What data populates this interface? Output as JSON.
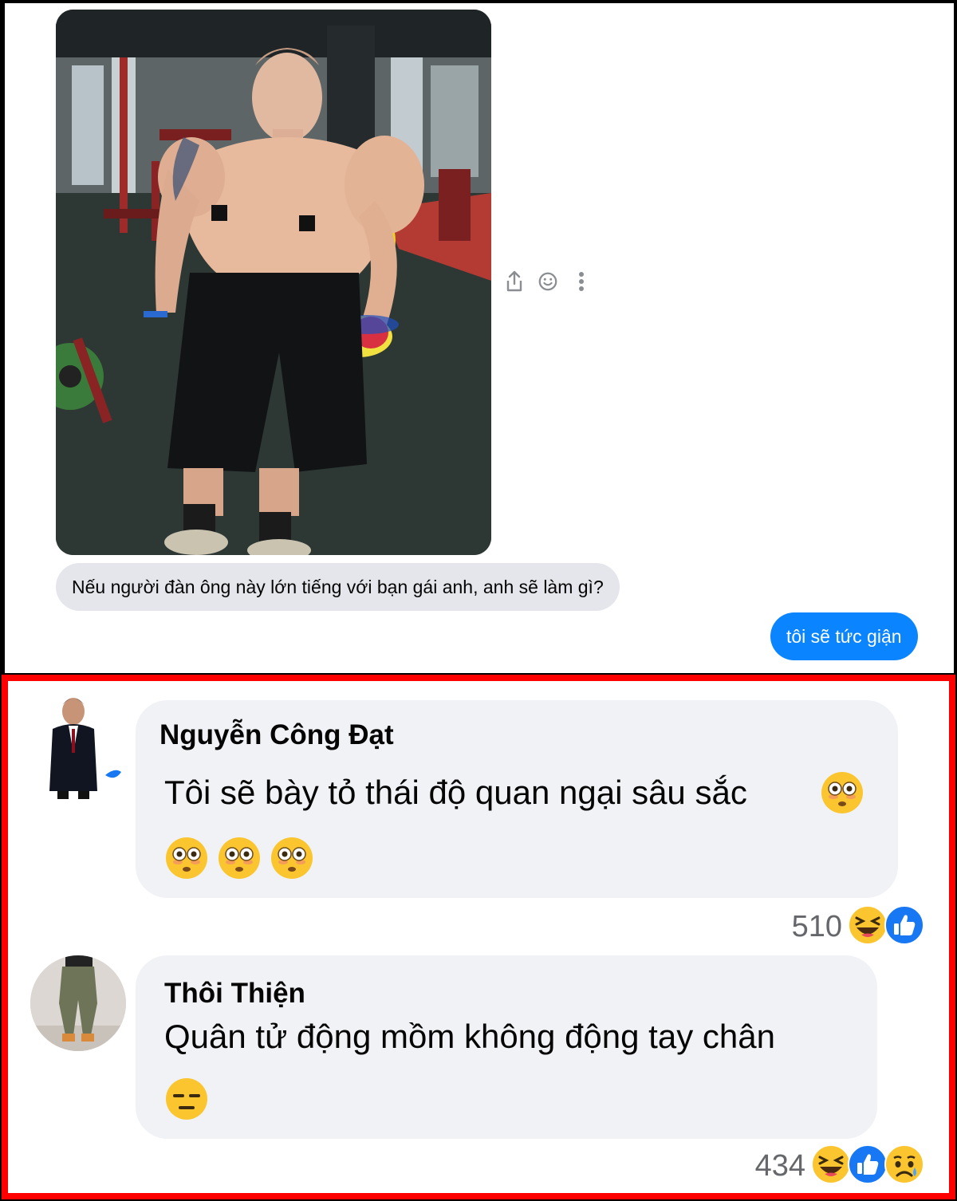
{
  "chat": {
    "incoming_message": "Nếu người đàn ông này lớn tiếng với bạn gái anh, anh sẽ làm gì?",
    "outgoing_message": "tôi sẽ tức giận",
    "actions": [
      "share-icon",
      "smiley-icon",
      "more-vertical-icon"
    ]
  },
  "comments": [
    {
      "author": "Nguyễn Công Đạt",
      "text": "Tôi sẽ bày tỏ thái độ quan ngại sâu sắc",
      "emoji": [
        "flushed-face",
        "flushed-face",
        "flushed-face",
        "flushed-face"
      ],
      "reaction_count": "510",
      "reactions": [
        "haha",
        "like"
      ]
    },
    {
      "author": "Thôi Thiện",
      "text": "Quân tử động mồm không động tay chân",
      "emoji": [
        "expressionless-face"
      ],
      "reaction_count": "434",
      "reactions": [
        "haha",
        "like",
        "sad"
      ]
    }
  ],
  "colors": {
    "frame_red": "#ff0000",
    "outgoing_bubble": "#0a84ff",
    "incoming_bubble": "#e4e6eb",
    "comment_bubble": "#f0f2f5"
  }
}
